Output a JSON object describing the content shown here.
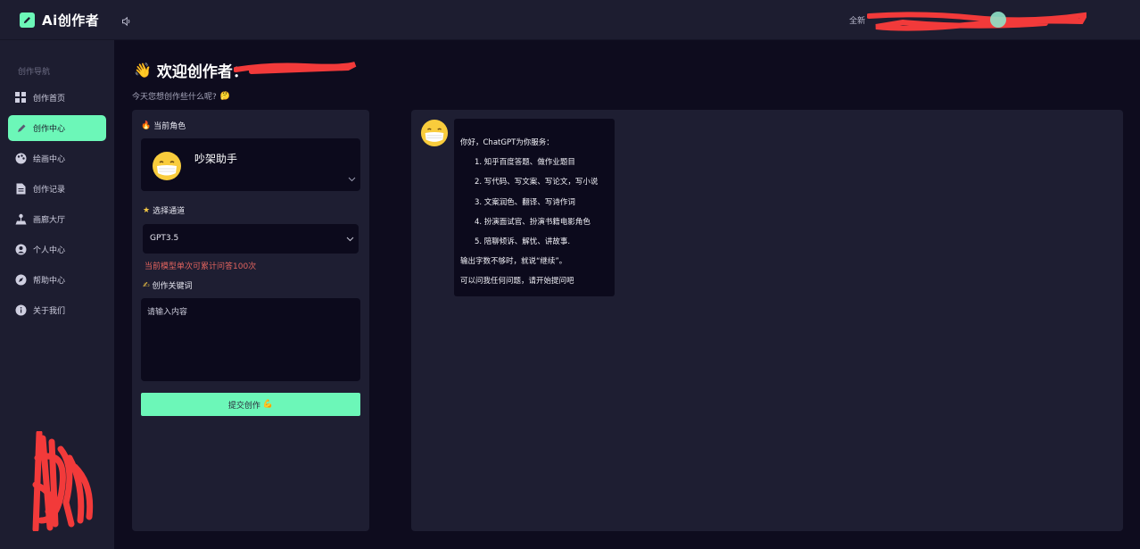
{
  "app": {
    "title": "Ai创作者"
  },
  "header": {
    "notice_text": "全新"
  },
  "sidebar": {
    "heading": "创作导航",
    "items": [
      {
        "label": "创作首页",
        "icon": "grid-icon",
        "active": false
      },
      {
        "label": "创作中心",
        "icon": "brush-icon",
        "active": true
      },
      {
        "label": "绘画中心",
        "icon": "palette-icon",
        "active": false
      },
      {
        "label": "创作记录",
        "icon": "document-icon",
        "active": false
      },
      {
        "label": "画廊大厅",
        "icon": "joystick-icon",
        "active": false
      },
      {
        "label": "个人中心",
        "icon": "user-icon",
        "active": false
      },
      {
        "label": "帮助中心",
        "icon": "compass-icon",
        "active": false
      },
      {
        "label": "关于我们",
        "icon": "info-icon",
        "active": false
      }
    ]
  },
  "main": {
    "welcome_title": "欢迎创作者：",
    "welcome_emoji": "👋",
    "subtitle": "今天您想创作些什么呢?",
    "subtitle_emoji": "🤔"
  },
  "form": {
    "role_label": "当前角色",
    "role_label_emoji": "🔥",
    "role_name": "吵架助手",
    "channel_label": "选择通道",
    "channel_label_emoji": "★",
    "channel_value": "GPT3.5",
    "channel_hint": "当前模型单次可累计问答100次",
    "keyword_label": "创作关键词",
    "keyword_label_emoji": "✍",
    "keyword_placeholder": "请输入内容",
    "submit_label": "提交创作",
    "submit_emoji": "💪"
  },
  "chat": {
    "greeting": "你好，ChatGPT为你服务：",
    "list": [
      "1. 知乎百度答题、做作业题目",
      "2. 写代码、写文案、写论文，写小说",
      "3. 文案润色、翻译、写诗作词",
      "4. 扮演面试官、扮演书籍电影角色",
      "5. 陪聊倾诉、解忧、讲故事."
    ],
    "line_continue": "输出字数不够时，就说“继续”。",
    "line_ask": "可以问我任何问题，请开始提问吧"
  },
  "colors": {
    "accent": "#6cf7b8",
    "panel": "#1e1e32",
    "background": "#0e0c1e",
    "input_bg": "#0c0a1c",
    "warning": "#e0635e",
    "redaction": "#f23a3a"
  }
}
